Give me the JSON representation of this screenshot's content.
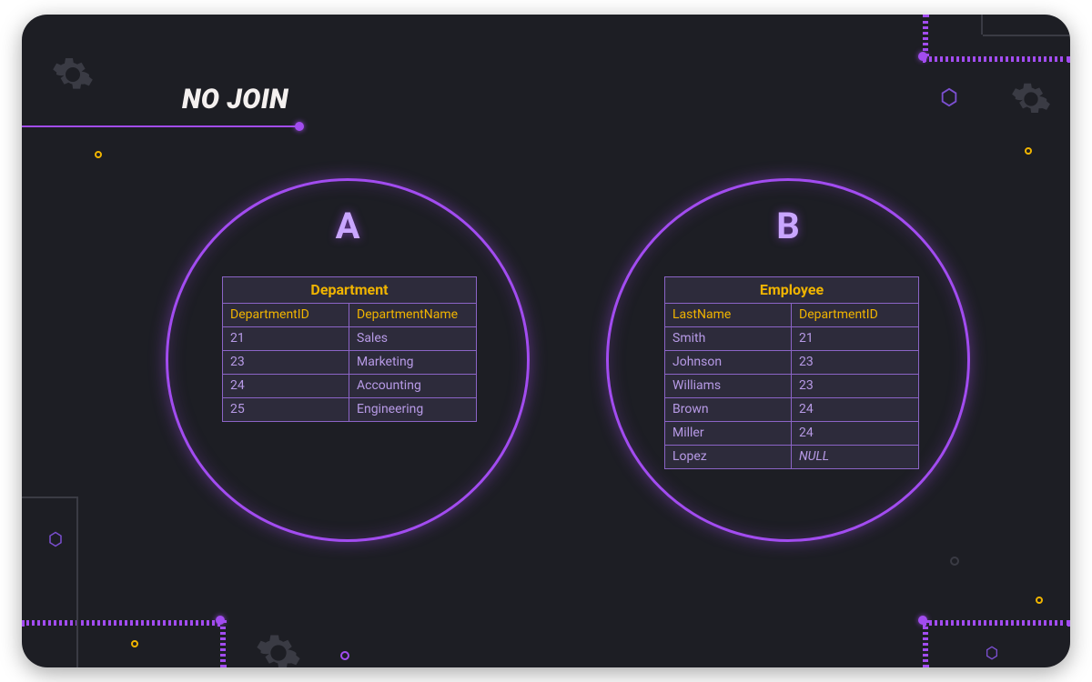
{
  "title": "NO JOIN",
  "sets": {
    "a": {
      "label": "A"
    },
    "b": {
      "label": "B"
    }
  },
  "tables": {
    "department": {
      "caption": "Department",
      "columns": [
        "DepartmentID",
        "DepartmentName"
      ],
      "rows": [
        [
          "21",
          "Sales"
        ],
        [
          "23",
          "Marketing"
        ],
        [
          "24",
          "Accounting"
        ],
        [
          "25",
          "Engineering"
        ]
      ]
    },
    "employee": {
      "caption": "Employee",
      "columns": [
        "LastName",
        "DepartmentID"
      ],
      "rows": [
        [
          "Smith",
          "21"
        ],
        [
          "Johnson",
          "23"
        ],
        [
          "Williams",
          "23"
        ],
        [
          "Brown",
          "24"
        ],
        [
          "Miller",
          "24"
        ],
        [
          "Lopez",
          "NULL"
        ]
      ]
    }
  },
  "colors": {
    "accent_purple": "#a24cf0",
    "accent_yellow": "#f0b400",
    "bg": "#1d1e24"
  }
}
